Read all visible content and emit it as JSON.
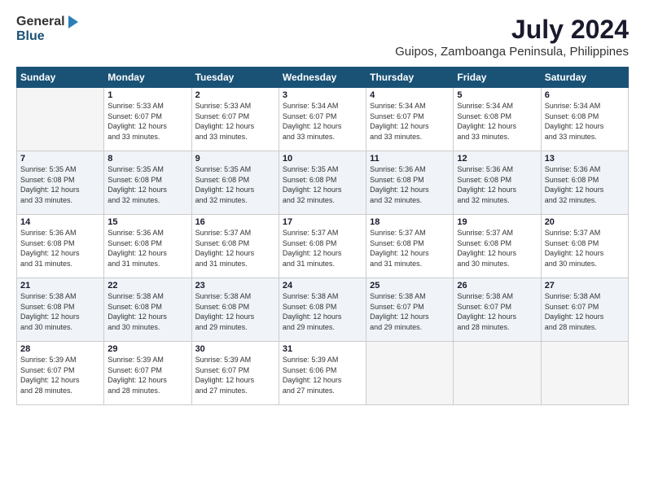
{
  "header": {
    "logo_general": "General",
    "logo_blue": "Blue",
    "month_title": "July 2024",
    "location": "Guipos, Zamboanga Peninsula, Philippines"
  },
  "days_of_week": [
    "Sunday",
    "Monday",
    "Tuesday",
    "Wednesday",
    "Thursday",
    "Friday",
    "Saturday"
  ],
  "weeks": [
    [
      {
        "day": "",
        "info": ""
      },
      {
        "day": "1",
        "info": "Sunrise: 5:33 AM\nSunset: 6:07 PM\nDaylight: 12 hours\nand 33 minutes."
      },
      {
        "day": "2",
        "info": "Sunrise: 5:33 AM\nSunset: 6:07 PM\nDaylight: 12 hours\nand 33 minutes."
      },
      {
        "day": "3",
        "info": "Sunrise: 5:34 AM\nSunset: 6:07 PM\nDaylight: 12 hours\nand 33 minutes."
      },
      {
        "day": "4",
        "info": "Sunrise: 5:34 AM\nSunset: 6:07 PM\nDaylight: 12 hours\nand 33 minutes."
      },
      {
        "day": "5",
        "info": "Sunrise: 5:34 AM\nSunset: 6:08 PM\nDaylight: 12 hours\nand 33 minutes."
      },
      {
        "day": "6",
        "info": "Sunrise: 5:34 AM\nSunset: 6:08 PM\nDaylight: 12 hours\nand 33 minutes."
      }
    ],
    [
      {
        "day": "7",
        "info": "Sunrise: 5:35 AM\nSunset: 6:08 PM\nDaylight: 12 hours\nand 33 minutes."
      },
      {
        "day": "8",
        "info": "Sunrise: 5:35 AM\nSunset: 6:08 PM\nDaylight: 12 hours\nand 32 minutes."
      },
      {
        "day": "9",
        "info": "Sunrise: 5:35 AM\nSunset: 6:08 PM\nDaylight: 12 hours\nand 32 minutes."
      },
      {
        "day": "10",
        "info": "Sunrise: 5:35 AM\nSunset: 6:08 PM\nDaylight: 12 hours\nand 32 minutes."
      },
      {
        "day": "11",
        "info": "Sunrise: 5:36 AM\nSunset: 6:08 PM\nDaylight: 12 hours\nand 32 minutes."
      },
      {
        "day": "12",
        "info": "Sunrise: 5:36 AM\nSunset: 6:08 PM\nDaylight: 12 hours\nand 32 minutes."
      },
      {
        "day": "13",
        "info": "Sunrise: 5:36 AM\nSunset: 6:08 PM\nDaylight: 12 hours\nand 32 minutes."
      }
    ],
    [
      {
        "day": "14",
        "info": "Sunrise: 5:36 AM\nSunset: 6:08 PM\nDaylight: 12 hours\nand 31 minutes."
      },
      {
        "day": "15",
        "info": "Sunrise: 5:36 AM\nSunset: 6:08 PM\nDaylight: 12 hours\nand 31 minutes."
      },
      {
        "day": "16",
        "info": "Sunrise: 5:37 AM\nSunset: 6:08 PM\nDaylight: 12 hours\nand 31 minutes."
      },
      {
        "day": "17",
        "info": "Sunrise: 5:37 AM\nSunset: 6:08 PM\nDaylight: 12 hours\nand 31 minutes."
      },
      {
        "day": "18",
        "info": "Sunrise: 5:37 AM\nSunset: 6:08 PM\nDaylight: 12 hours\nand 31 minutes."
      },
      {
        "day": "19",
        "info": "Sunrise: 5:37 AM\nSunset: 6:08 PM\nDaylight: 12 hours\nand 30 minutes."
      },
      {
        "day": "20",
        "info": "Sunrise: 5:37 AM\nSunset: 6:08 PM\nDaylight: 12 hours\nand 30 minutes."
      }
    ],
    [
      {
        "day": "21",
        "info": "Sunrise: 5:38 AM\nSunset: 6:08 PM\nDaylight: 12 hours\nand 30 minutes."
      },
      {
        "day": "22",
        "info": "Sunrise: 5:38 AM\nSunset: 6:08 PM\nDaylight: 12 hours\nand 30 minutes."
      },
      {
        "day": "23",
        "info": "Sunrise: 5:38 AM\nSunset: 6:08 PM\nDaylight: 12 hours\nand 29 minutes."
      },
      {
        "day": "24",
        "info": "Sunrise: 5:38 AM\nSunset: 6:08 PM\nDaylight: 12 hours\nand 29 minutes."
      },
      {
        "day": "25",
        "info": "Sunrise: 5:38 AM\nSunset: 6:07 PM\nDaylight: 12 hours\nand 29 minutes."
      },
      {
        "day": "26",
        "info": "Sunrise: 5:38 AM\nSunset: 6:07 PM\nDaylight: 12 hours\nand 28 minutes."
      },
      {
        "day": "27",
        "info": "Sunrise: 5:38 AM\nSunset: 6:07 PM\nDaylight: 12 hours\nand 28 minutes."
      }
    ],
    [
      {
        "day": "28",
        "info": "Sunrise: 5:39 AM\nSunset: 6:07 PM\nDaylight: 12 hours\nand 28 minutes."
      },
      {
        "day": "29",
        "info": "Sunrise: 5:39 AM\nSunset: 6:07 PM\nDaylight: 12 hours\nand 28 minutes."
      },
      {
        "day": "30",
        "info": "Sunrise: 5:39 AM\nSunset: 6:07 PM\nDaylight: 12 hours\nand 27 minutes."
      },
      {
        "day": "31",
        "info": "Sunrise: 5:39 AM\nSunset: 6:06 PM\nDaylight: 12 hours\nand 27 minutes."
      },
      {
        "day": "",
        "info": ""
      },
      {
        "day": "",
        "info": ""
      },
      {
        "day": "",
        "info": ""
      }
    ]
  ]
}
